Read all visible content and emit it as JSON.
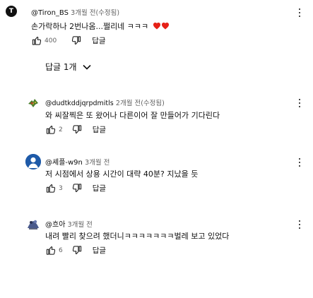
{
  "thread": {
    "author": "@Tiron_BS",
    "meta": "3개월 전(수정됨)",
    "text": "손가락하나 2번나옴...쩔리네 ㅋㅋㅋ",
    "likes": "400",
    "reply_label": "답글",
    "replies_toggle": "답글 1개"
  },
  "replies": [
    {
      "author": "@dudtkddjqrpdmitls",
      "meta": "2개월 전(수정됨)",
      "text": "와 씨잘찍은 또 왔어나 다른이어 잘 만들어가 기다린다",
      "likes": "2",
      "reply_label": "답글",
      "avatar_color": "#ffffff"
    },
    {
      "author": "@셰플-w9n",
      "meta": "3개월 전",
      "text": "저 시점에서 상용 시간이 대략 40분? 지났을 듯",
      "likes": "3",
      "reply_label": "답글",
      "avatar_color": "#1e5aa8"
    },
    {
      "author": "@흐아",
      "meta": "3개월 전",
      "text": "내려 빨리 찾으려 했더니ㅋㅋㅋㅋㅋㅋㅋ벌레 보고 있었다",
      "likes": "6",
      "reply_label": "답글",
      "avatar_color": "#4a5a8c"
    }
  ],
  "colors": {
    "heart": "#e62117",
    "text": "#0f0f0f",
    "meta": "#606060"
  },
  "icons": [
    "like-icon",
    "dislike-icon",
    "heart-icon",
    "more-vert-icon",
    "chevron-down-icon"
  ]
}
